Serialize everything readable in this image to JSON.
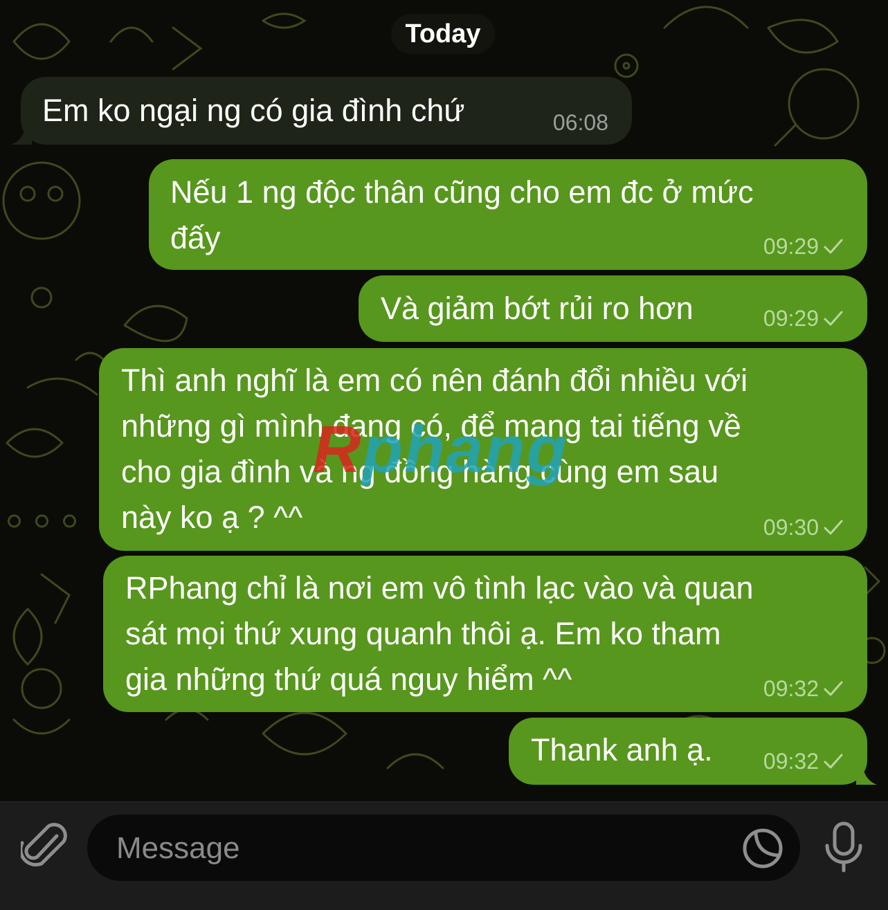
{
  "date_separator": "Today",
  "messages": [
    {
      "direction": "in",
      "lines": [
        "Em ko ngại ng có gia đình chứ"
      ],
      "time": "06:08"
    },
    {
      "direction": "out",
      "lines": [
        "Nếu 1 ng độc thân cũng cho em đc ở mức",
        "đấy"
      ],
      "time": "09:29",
      "status": "sent-check-icon"
    },
    {
      "direction": "out",
      "lines": [
        "Và giảm bớt rủi ro hơn"
      ],
      "time": "09:29",
      "status": "sent-check-icon"
    },
    {
      "direction": "out",
      "lines": [
        "Thì anh nghĩ là em có nên đánh đổi nhiều với",
        "những gì mình đang có, để mang tai tiếng về",
        "cho gia đình và ng đồng hàng cùng em sau",
        "này ko ạ ? ^^"
      ],
      "time": "09:30",
      "status": "sent-check-icon"
    },
    {
      "direction": "out",
      "lines": [
        "RPhang chỉ là nơi em vô tình lạc vào và quan",
        "sát mọi thứ xung quanh thôi ạ. Em ko tham",
        "gia những thứ quá nguy hiểm ^^"
      ],
      "time": "09:32",
      "status": "sent-check-icon"
    },
    {
      "direction": "out",
      "lines": [
        "Thank anh ạ."
      ],
      "time": "09:32",
      "status": "sent-check-icon"
    }
  ],
  "watermark": {
    "first": "R",
    "rest": "phang"
  },
  "composer": {
    "placeholder": "Message",
    "attach_icon": "paperclip-icon",
    "sticker_icon": "sticker-icon",
    "mic_icon": "microphone-icon"
  },
  "colors": {
    "incoming_bubble": "#1f2419",
    "outgoing_bubble": "#57971d",
    "background": "#0b0c07",
    "doodle": "#3e4a1c"
  }
}
